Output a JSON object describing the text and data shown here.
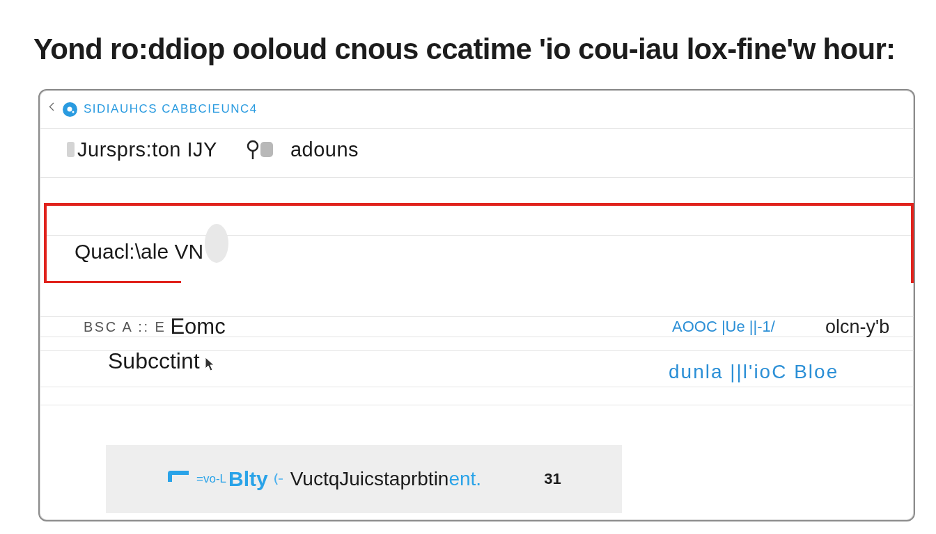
{
  "heading": "Yond ro:ddiop ooloud cnous ccatime 'io cou-iau lox-fine'w hour:",
  "panel": {
    "breadcrumb": "SIDIAUHCS CABBCIEUNC4",
    "title": "Jursprs:ton IJY",
    "action": "adouns",
    "highlighted_row": {
      "label": "Quacl:\\ale VN",
      "selected": true
    },
    "details": {
      "label_code": "BSC A :: E",
      "label": "Eomc",
      "sublabel": "Subcctint",
      "link": "AOOC |Ue ||-1/",
      "value": "olcn-y'b",
      "link_2": "dunla ||l'ioC Bloe"
    },
    "banner": {
      "prefix": "=vo-L",
      "brand": "Blty",
      "message": "VuctqJuicstaprbtin",
      "message_link": "ent.",
      "count": "31"
    }
  }
}
